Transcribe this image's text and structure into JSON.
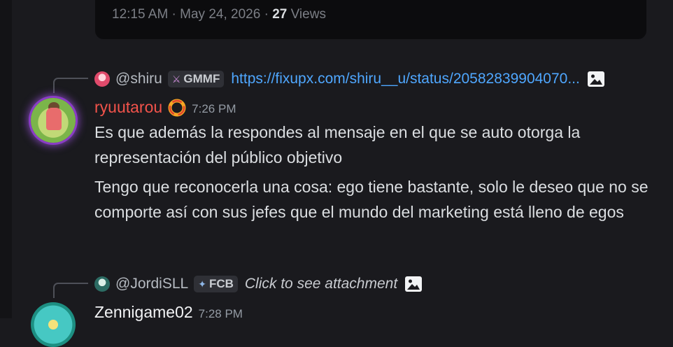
{
  "embed": {
    "footer_time": "12:15 AM · May 24, 2026 · ",
    "footer_views_count": "27",
    "footer_views_label": " Views"
  },
  "messages": [
    {
      "reply": {
        "user": "@shiru",
        "tag": "GMMF",
        "content": "https://fixupx.com/shiru__u/status/20582839904070..."
      },
      "author": "ryuutarou",
      "author_color": "#f2534b",
      "timestamp": "7:26 PM",
      "paragraphs": [
        "Es que además la respondes al mensaje en el que se auto otorga la representación del público objetivo",
        "Tengo que reconocerla una cosa: ego tiene bastante, solo le deseo que no se comporte así con sus jefes que el mundo del marketing está lleno de egos"
      ]
    },
    {
      "reply": {
        "user": "@JordiSLL",
        "tag": "FCB",
        "content": "Click to see attachment"
      },
      "author": "Zennigame02",
      "author_color": "#f2f3f5",
      "timestamp": "7:28 PM"
    }
  ],
  "icons": {
    "image": "image-icon",
    "role": "ring-role-icon"
  }
}
